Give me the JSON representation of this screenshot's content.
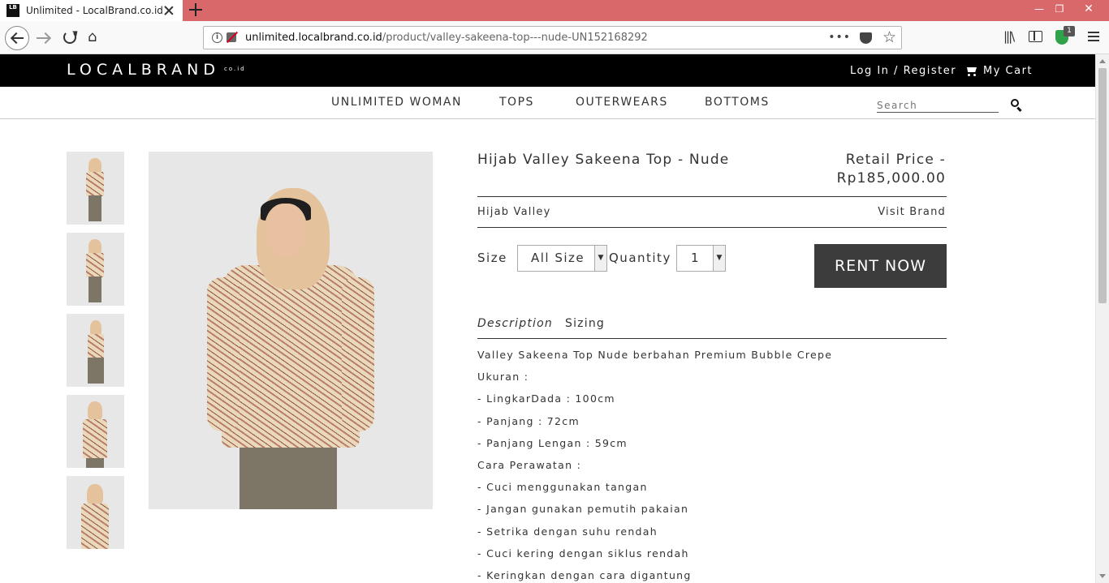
{
  "browser": {
    "tab_title": "Unlimited - LocalBrand.co.id",
    "favicon_text": "LB",
    "url_host": "unlimited.localbrand.co.id",
    "url_path": "/product/valley-sakeena-top---nude-UN152168292",
    "extension_badge": "1",
    "titlebar_color": "#d9686a"
  },
  "site": {
    "logo": "LOCALBRAND",
    "logo_suffix": "co.id",
    "auth_text": "Log In / Register",
    "cart_label": "My Cart",
    "categories": [
      "UNLIMITED WOMAN",
      "TOPS",
      "OUTERWEARS",
      "BOTTOMS"
    ],
    "search_placeholder": "Search"
  },
  "product": {
    "title": "Hijab Valley Sakeena Top - Nude",
    "price_label": "Retail Price -",
    "price": "Rp185,000.00",
    "brand": "Hijab Valley",
    "visit_brand": "Visit Brand",
    "size_label": "Size",
    "size_value": "All Size",
    "quantity_label": "Quantity",
    "quantity_value": "1",
    "rent_button": "RENT NOW",
    "tabs": {
      "description": "Description",
      "sizing": "Sizing"
    },
    "description": [
      "Valley Sakeena Top Nude berbahan Premium Bubble Crepe",
      "Ukuran :",
      "- LingkarDada : 100cm",
      "- Panjang : 72cm",
      "- Panjang Lengan : 59cm",
      "Cara Perawatan :",
      "- Cuci menggunakan tangan",
      "- Jangan gunakan pemutih pakaian",
      "- Setrika dengan suhu rendah",
      "- Cuci kering dengan siklus rendah",
      "- Keringkan dengan cara digantung"
    ]
  }
}
